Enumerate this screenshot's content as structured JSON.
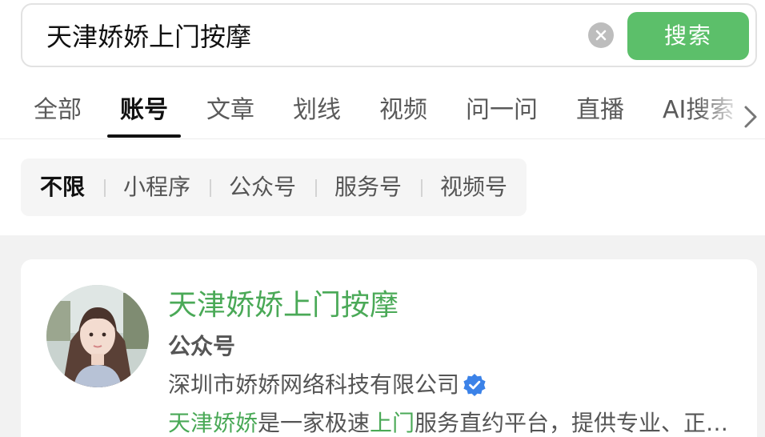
{
  "search": {
    "query": "天津娇娇上门按摩",
    "button_label": "搜索"
  },
  "tabs": [
    {
      "label": "全部"
    },
    {
      "label": "账号"
    },
    {
      "label": "文章"
    },
    {
      "label": "划线"
    },
    {
      "label": "视频"
    },
    {
      "label": "问一问"
    },
    {
      "label": "直播"
    },
    {
      "label": "AI搜索"
    }
  ],
  "active_tab": "账号",
  "filters": [
    {
      "label": "不限"
    },
    {
      "label": "小程序"
    },
    {
      "label": "公众号"
    },
    {
      "label": "服务号"
    },
    {
      "label": "视频号"
    }
  ],
  "active_filter": "不限",
  "result": {
    "title": "天津娇娇上门按摩",
    "type": "公众号",
    "organization": "深圳市娇娇网络科技有限公司",
    "description": {
      "part1": "天津娇娇",
      "part2": "是一家极速",
      "part3": "上门",
      "part4": "服务直约平台，提供专业、正…"
    }
  },
  "colors": {
    "accent_green": "#5cbf6a",
    "highlight_green": "#4aa957",
    "verified_blue": "#3b82e8"
  },
  "icons": {
    "clear": "close-circle-icon",
    "more_tabs": "chevron-right-icon",
    "verified": "verified-badge-icon"
  }
}
